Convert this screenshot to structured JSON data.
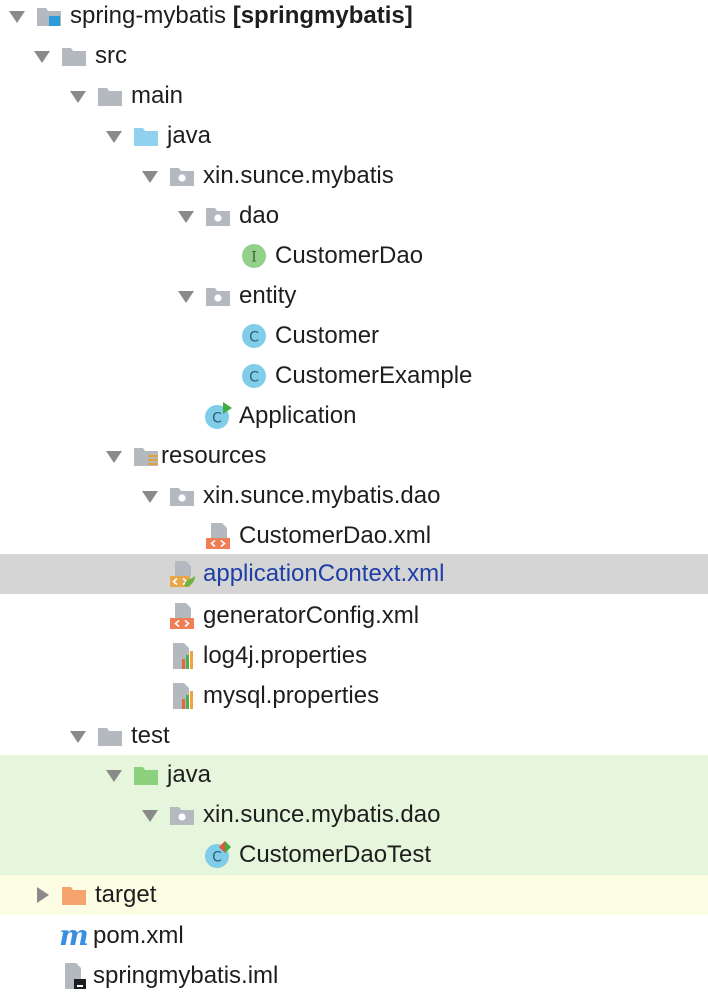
{
  "tree": {
    "root": {
      "name": "spring-mybatis",
      "module": "[springmybatis]"
    },
    "items": [
      {
        "label": "src"
      },
      {
        "label": "main"
      },
      {
        "label": "java"
      },
      {
        "label": "xin.sunce.mybatis"
      },
      {
        "label": "dao"
      },
      {
        "label": "CustomerDao"
      },
      {
        "label": "entity"
      },
      {
        "label": "Customer"
      },
      {
        "label": "CustomerExample"
      },
      {
        "label": "Application"
      },
      {
        "label": "resources"
      },
      {
        "label": "xin.sunce.mybatis.dao"
      },
      {
        "label": "CustomerDao.xml"
      },
      {
        "label": "applicationContext.xml"
      },
      {
        "label": "generatorConfig.xml"
      },
      {
        "label": "log4j.properties"
      },
      {
        "label": "mysql.properties"
      },
      {
        "label": "test"
      },
      {
        "label": "java"
      },
      {
        "label": "xin.sunce.mybatis.dao"
      },
      {
        "label": "CustomerDaoTest"
      },
      {
        "label": "target"
      },
      {
        "label": "pom.xml"
      },
      {
        "label": "springmybatis.iml"
      }
    ],
    "icon_glyphs": {
      "interface": "I",
      "class": "C",
      "maven": "m"
    }
  },
  "colors": {
    "folder_gray": "#b4b9bf",
    "source_folder": "#8fd1ee",
    "test_folder": "#8cd17e",
    "target_folder": "#f6a46e",
    "class_icon": "#7fcde8",
    "interface_icon": "#93d08c",
    "xml_badge": "#ef7d55",
    "selection": "#d5d5d5",
    "test_row": "#e5f6dc",
    "excluded_row": "#fdfde3",
    "link_text": "#1f3ea6",
    "maven_blue": "#3b8fe0"
  }
}
